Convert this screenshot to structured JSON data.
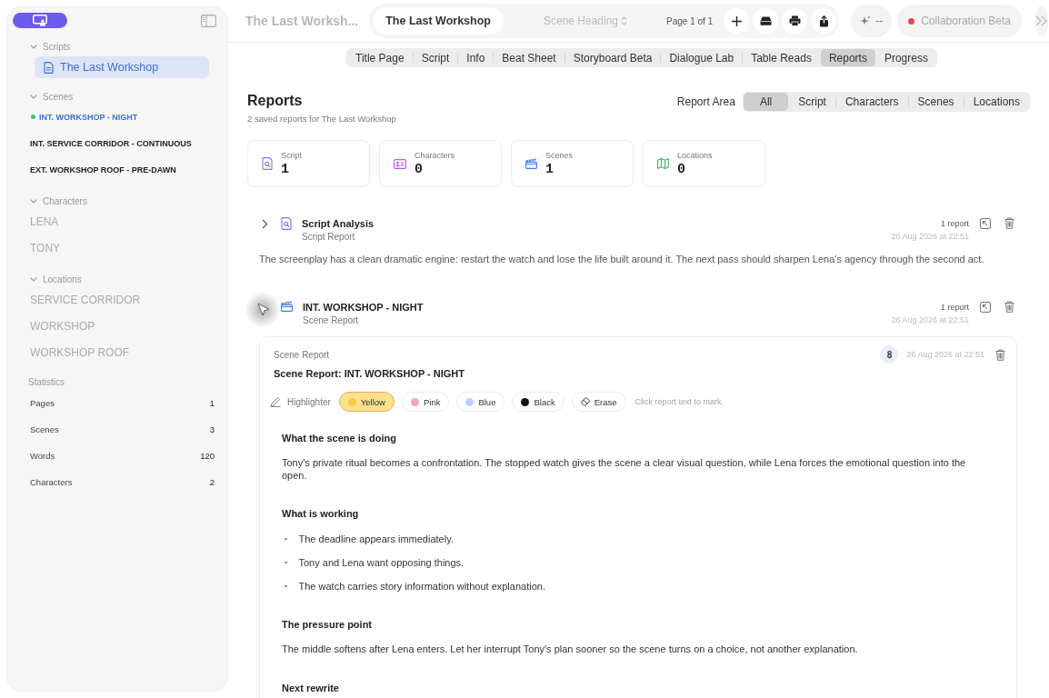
{
  "sidebar": {
    "sections": [
      {
        "kind": "script",
        "title": "Scripts",
        "expanded": true,
        "items": [
          {
            "label": "The Last Workshop",
            "selected": true
          }
        ]
      },
      {
        "kind": "scene",
        "title": "Scenes",
        "expanded": true,
        "items": [
          {
            "label": "INT. WORKSHOP - NIGHT",
            "selected": true
          },
          {
            "label": "INT. SERVICE CORRIDOR - CONTINUOUS",
            "selected": false
          },
          {
            "label": "EXT. WORKSHOP ROOF - PRE-DAWN",
            "selected": false
          }
        ]
      },
      {
        "kind": "name",
        "title": "Characters",
        "expanded": true,
        "items": [
          {
            "label": "LENA",
            "selected": false
          },
          {
            "label": "TONY",
            "selected": false
          }
        ]
      },
      {
        "kind": "name",
        "title": "Locations",
        "expanded": true,
        "items": [
          {
            "label": "SERVICE CORRIDOR",
            "selected": false
          },
          {
            "label": "WORKSHOP",
            "selected": false
          },
          {
            "label": "WORKSHOP ROOF",
            "selected": false
          }
        ]
      }
    ],
    "statistics": {
      "title": "Statistics",
      "rows": [
        {
          "label": "Pages",
          "value": "1"
        },
        {
          "label": "Scenes",
          "value": "3"
        },
        {
          "label": "Words",
          "value": "120"
        },
        {
          "label": "Characters",
          "value": "2"
        }
      ]
    }
  },
  "toolbar": {
    "title": "The Last Worksh...",
    "document_tab": "The Last Workshop",
    "element_type": "Scene Heading",
    "page_indicator": "Page 1 of 1",
    "ai_status": "--",
    "collaboration": {
      "label": "Collaboration Beta",
      "connected": false
    }
  },
  "tabs": [
    {
      "label": "Title Page",
      "selected": false
    },
    {
      "label": "Script",
      "selected": false
    },
    {
      "label": "Info",
      "selected": false
    },
    {
      "label": "Beat Sheet",
      "selected": false
    },
    {
      "label": "Storyboard Beta",
      "selected": false
    },
    {
      "label": "Dialogue Lab",
      "selected": false
    },
    {
      "label": "Table Reads",
      "selected": false
    },
    {
      "label": "Reports",
      "selected": true
    },
    {
      "label": "Progress",
      "selected": false
    }
  ],
  "reports": {
    "title": "Reports",
    "subtitle": "2 saved reports for The Last Workshop",
    "filter": {
      "label": "Report Area",
      "options": [
        {
          "label": "All",
          "selected": true
        },
        {
          "label": "Script",
          "selected": false
        },
        {
          "label": "Characters",
          "selected": false
        },
        {
          "label": "Scenes",
          "selected": false
        },
        {
          "label": "Locations",
          "selected": false
        }
      ]
    },
    "stats": [
      {
        "kind": "script",
        "label": "Script",
        "value": "1"
      },
      {
        "kind": "characters",
        "label": "Characters",
        "value": "0"
      },
      {
        "kind": "scene",
        "label": "Scenes",
        "value": "1"
      },
      {
        "kind": "location",
        "label": "Locations",
        "value": "0"
      }
    ],
    "items": [
      {
        "kind": "script",
        "title": "Script Analysis",
        "subtitle": "Script Report",
        "count": "1 report",
        "date": "26 Aug 2026 at 22:51",
        "expanded": false,
        "hovered": false,
        "summary": "The screenplay has a clean dramatic engine: restart the watch and lose the life built around it. The next pass should sharpen Lena's agency through the second act."
      },
      {
        "kind": "scene",
        "title": "INT. WORKSHOP - NIGHT",
        "subtitle": "Scene Report",
        "count": "1 report",
        "date": "26 Aug 2026 at 22:51",
        "expanded": true,
        "hovered": true,
        "detail": {
          "type_label": "Scene Report",
          "title": "Scene Report: INT. WORKSHOP - NIGHT",
          "badge": "8",
          "date": "26 Aug 2026 at 22:51",
          "highlighter": {
            "label": "Highlighter",
            "tools": [
              {
                "kind": "color",
                "label": "Yellow",
                "color": "#f2cd45",
                "selected": true
              },
              {
                "kind": "color",
                "label": "Pink",
                "color": "#f3a6b3",
                "selected": false
              },
              {
                "kind": "color",
                "label": "Blue",
                "color": "#bcd0f6",
                "selected": false
              },
              {
                "kind": "color",
                "label": "Black",
                "color": "#111111",
                "selected": false
              },
              {
                "kind": "erase",
                "label": "Erase",
                "selected": false
              }
            ],
            "hint": "Click report text to mark."
          },
          "sections": [
            {
              "heading": "What the scene is doing",
              "paragraphs": [
                "Tony's private ritual becomes a confrontation. The stopped watch gives the scene a clear visual question, while Lena forces the emotional question into the open."
              ]
            },
            {
              "heading": "What is working",
              "bullets": [
                "The deadline appears immediately.",
                "Tony and Lena want opposing things.",
                "The watch carries story information without explanation."
              ]
            },
            {
              "heading": "The pressure point",
              "paragraphs": [
                "The middle softens after Lena enters. Let her interrupt Tony's plan sooner so the scene turns on a choice, not another explanation."
              ]
            },
            {
              "heading": "Next rewrite"
            }
          ]
        }
      }
    ]
  }
}
